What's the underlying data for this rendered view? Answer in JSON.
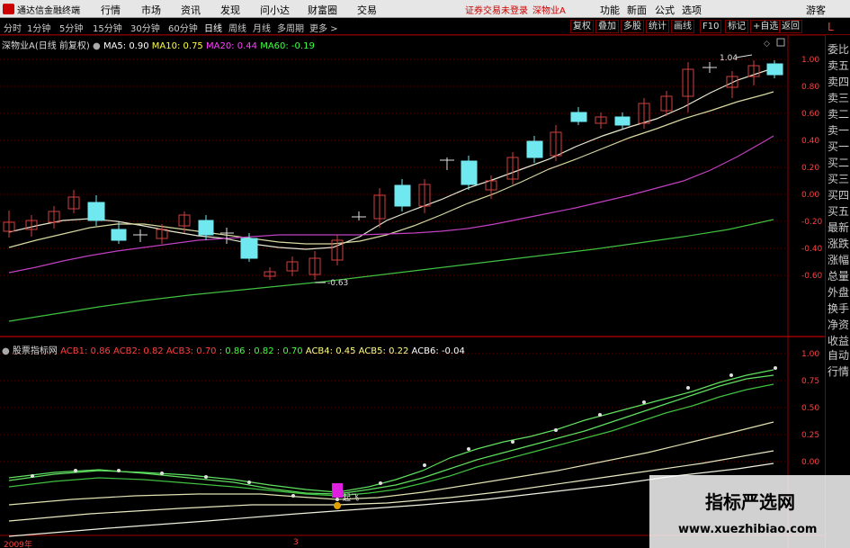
{
  "menubar": {
    "app_title": "通达信金融终端",
    "items": [
      "行情",
      "市场",
      "资讯",
      "发现",
      "问小达",
      "财富圈",
      "交易"
    ],
    "status_login": "证券交易未登录",
    "status_stock": "深物业A",
    "right_items": [
      "功能",
      "新面",
      "公式",
      "选项",
      "游客"
    ]
  },
  "periodbar": {
    "periods": [
      "分时",
      "1分钟",
      "5分钟",
      "15分钟",
      "30分钟",
      "60分钟",
      "日线",
      "周线",
      "月线",
      "多周期",
      "更多 >"
    ],
    "active": "日线",
    "tools": [
      "复权",
      "叠加",
      "多股",
      "统计",
      "画线",
      "F10",
      "标记",
      "+自选",
      "返回"
    ]
  },
  "chart1": {
    "title": "深物业A(日线 前复权)",
    "ma": [
      {
        "label": "MA5: 0.90",
        "color": "#ffffff"
      },
      {
        "label": "MA10: 0.75",
        "color": "#ffff40"
      },
      {
        "label": "MA20: 0.44",
        "color": "#ff40ff"
      },
      {
        "label": "MA60: -0.19",
        "color": "#40ff40"
      }
    ],
    "high_label": "1.04",
    "low_label": "-0.63",
    "y_ticks": [
      "1.00",
      "0.80",
      "0.60",
      "0.40",
      "0.20",
      "0.00",
      "-0.20",
      "-0.40",
      "-0.60"
    ]
  },
  "chart2": {
    "title": "股票指标网",
    "acb": [
      {
        "label": "ACB1: 0.86",
        "color": "#ff4040"
      },
      {
        "label": "ACB2: 0.82",
        "color": "#ff4040"
      },
      {
        "label": "ACB3: 0.70",
        "color": "#ff4040"
      },
      {
        "label": ": 0.86",
        "color": "#40ff40"
      },
      {
        "label": ": 0.82",
        "color": "#40ff40"
      },
      {
        "label": ": 0.70",
        "color": "#40ff40"
      },
      {
        "label": "ACB4: 0.45",
        "color": "#ffff80"
      },
      {
        "label": "ACB5: 0.22",
        "color": "#ffff80"
      },
      {
        "label": "ACB6: -0.04",
        "color": "#ffffff"
      }
    ],
    "signal_label": "起飞",
    "y_ticks": [
      "1.00",
      "0.75",
      "0.50",
      "0.25",
      "0.00"
    ]
  },
  "x_labels": [
    "2009年",
    "3"
  ],
  "right_panel": {
    "top_items": [
      "委比",
      "卖五",
      "卖四",
      "卖三",
      "卖二",
      "卖一",
      "买一",
      "买二",
      "买三",
      "买四",
      "买五",
      "最新",
      "涨跌",
      "涨幅",
      "总量",
      "外盘",
      "换手",
      "净资",
      "收益"
    ],
    "bottom_items": [
      "自动",
      "行情"
    ]
  },
  "watermark": {
    "title": "指标严选网",
    "url": "www.xuezhibiao.com"
  }
}
